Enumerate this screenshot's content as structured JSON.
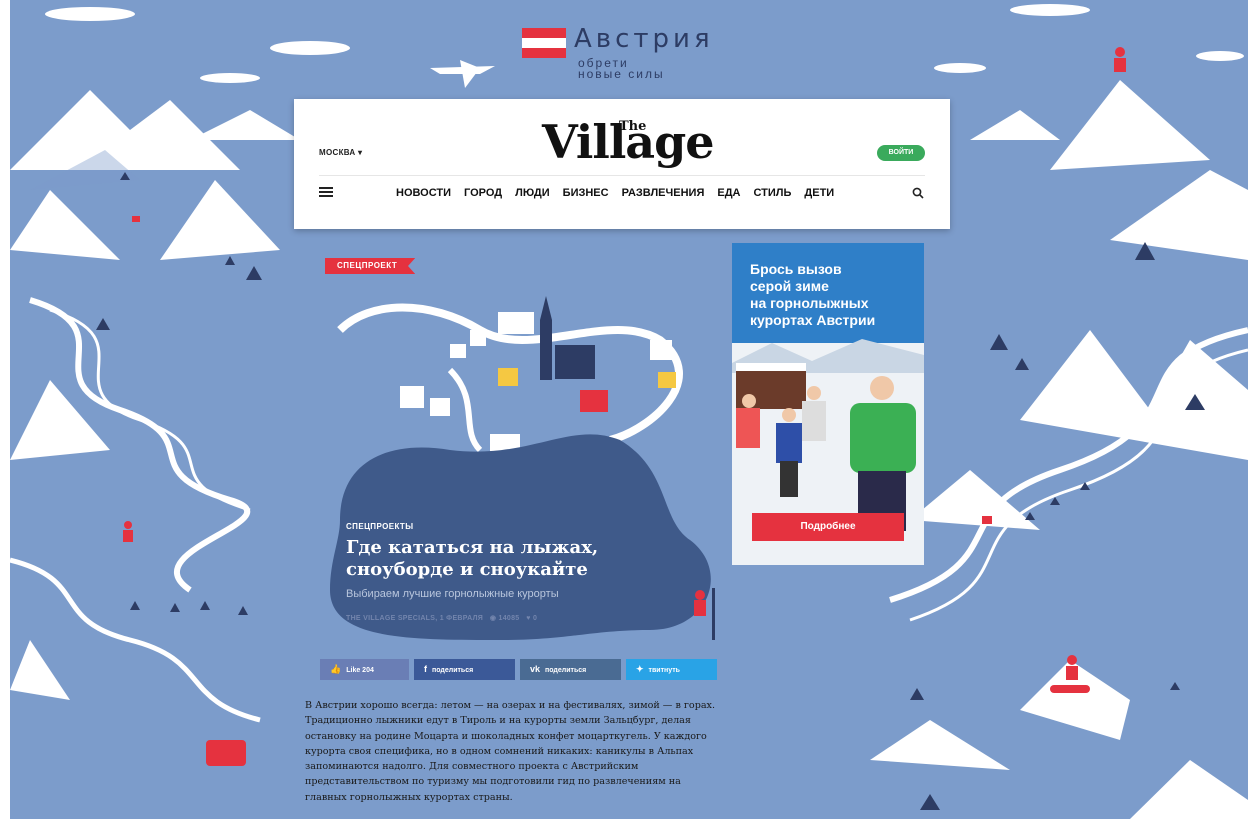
{
  "promo": {
    "title": "Австрия",
    "subtitle_line1": "обрети",
    "subtitle_line2": "новые силы",
    "flag_colors": [
      "#e5323f",
      "#ffffff",
      "#e5323f"
    ]
  },
  "header": {
    "city": "МОСКВА",
    "logo_the": "The",
    "logo": "Village",
    "login_label": "ВОЙТИ",
    "nav": [
      "НОВОСТИ",
      "ГОРОД",
      "ЛЮДИ",
      "БИЗНЕС",
      "РАЗВЛЕЧЕНИЯ",
      "ЕДА",
      "СТИЛЬ",
      "ДЕТИ"
    ],
    "icons": {
      "menu": "hamburger-icon",
      "search": "search-icon",
      "city_dropdown": "caret-down-icon"
    }
  },
  "article": {
    "tag": "СПЕЦПРОЕКТ",
    "kicker": "СПЕЦПРОЕКТЫ",
    "headline": "Где кататься на лыжах, сноуборде и сноукайте",
    "subhead": "Выбираем лучшие горнолыжные курорты",
    "meta_source": "THE VILLAGE SPECIALS",
    "meta_date": "1 ФЕВРАЛЯ",
    "meta_views": "14085",
    "meta_comments": "0"
  },
  "share": {
    "like_label": "Like 204",
    "fb_label": "поделиться",
    "vk_label": "поделиться",
    "tw_label": "твитнуть"
  },
  "ad": {
    "text_line1": "Брось вызов",
    "text_line2": "серой зиме",
    "text_line3": "на горнолыжных",
    "text_line4": "курортах Австрии",
    "button_label": "Подробнее"
  },
  "body": {
    "paragraph": "В Австрии хорошо всегда: летом — на озерах и на фестивалях, зимой — в горах. Традиционно лыжники едут в Тироль и на курорты земли Зальцбург, делая остановку на родине Моцарта и шоколадных конфет моцарткугель. У каждого курорта своя специфика, но в одном сомнений никаких: каникулы в Альпах запоминаются надолго. Для совместного проекта с Австрийским представительством по туризму мы подготовили гид по развлечениям на главных горнолыжных курортах страны."
  },
  "colors": {
    "background": "#7c9ccb",
    "accent_red": "#e5323f",
    "login_green": "#3aaa5c",
    "blob": "#3f5a8a",
    "navy": "#2d3c64"
  }
}
